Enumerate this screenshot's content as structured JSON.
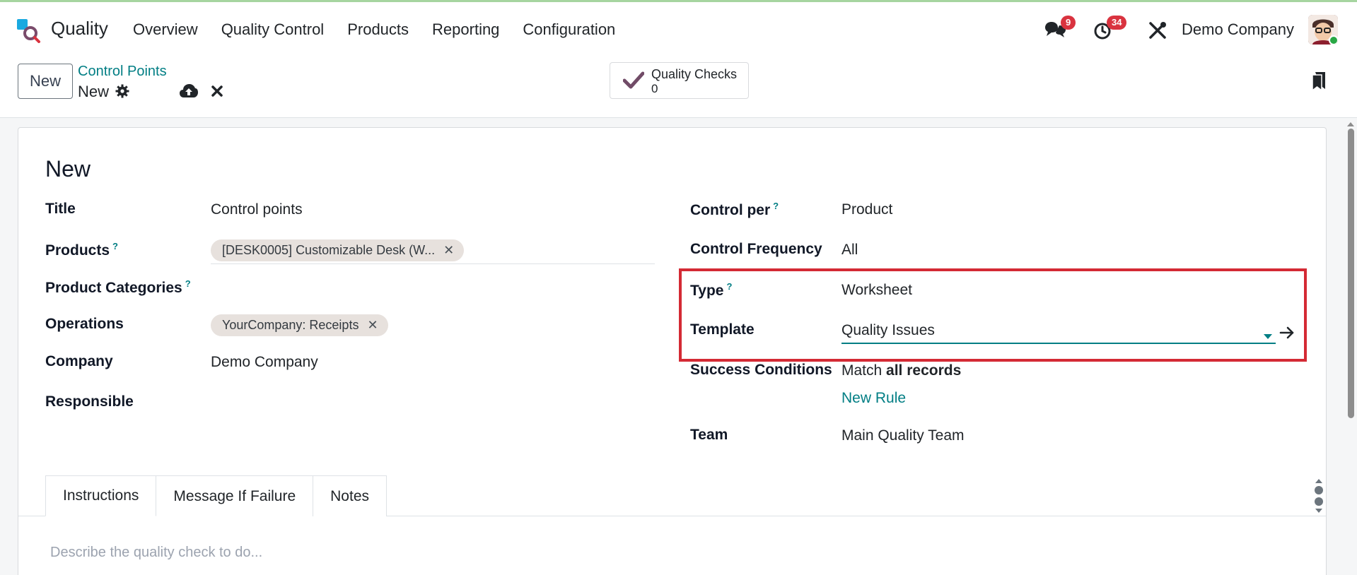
{
  "nav": {
    "app_name": "Quality",
    "menu": [
      "Overview",
      "Quality Control",
      "Products",
      "Reporting",
      "Configuration"
    ],
    "messages_count": "9",
    "activities_count": "34",
    "company": "Demo Company"
  },
  "control_panel": {
    "new_label": "New",
    "breadcrumb_parent": "Control Points",
    "breadcrumb_current": "New",
    "smart_button_label": "Quality Checks",
    "smart_button_value": "0"
  },
  "form": {
    "title": "New",
    "left": {
      "title_label": "Title",
      "title_value": "Control points",
      "products_label": "Products",
      "products_help": "?",
      "products_tag": "[DESK0005] Customizable Desk (W...",
      "product_categories_label": "Product Categories",
      "product_categories_help": "?",
      "operations_label": "Operations",
      "operations_tag": "YourCompany: Receipts",
      "company_label": "Company",
      "company_value": "Demo Company",
      "responsible_label": "Responsible"
    },
    "right": {
      "control_per_label": "Control per",
      "control_per_help": "?",
      "control_per_value": "Product",
      "control_frequency_label": "Control Frequency",
      "control_frequency_value": "All",
      "type_label": "Type",
      "type_help": "?",
      "type_value": "Worksheet",
      "template_label": "Template",
      "template_value": "Quality Issues",
      "success_conditions_label": "Success Conditions",
      "success_match": "Match",
      "success_records": "all records",
      "new_rule": "New Rule",
      "team_label": "Team",
      "team_value": "Main Quality Team"
    },
    "tabs": [
      "Instructions",
      "Message If Failure",
      "Notes"
    ],
    "instructions_placeholder": "Describe the quality check to do..."
  },
  "colors": {
    "accent": "#017e84",
    "highlight": "#d42a34",
    "badge": "#d9333f"
  }
}
